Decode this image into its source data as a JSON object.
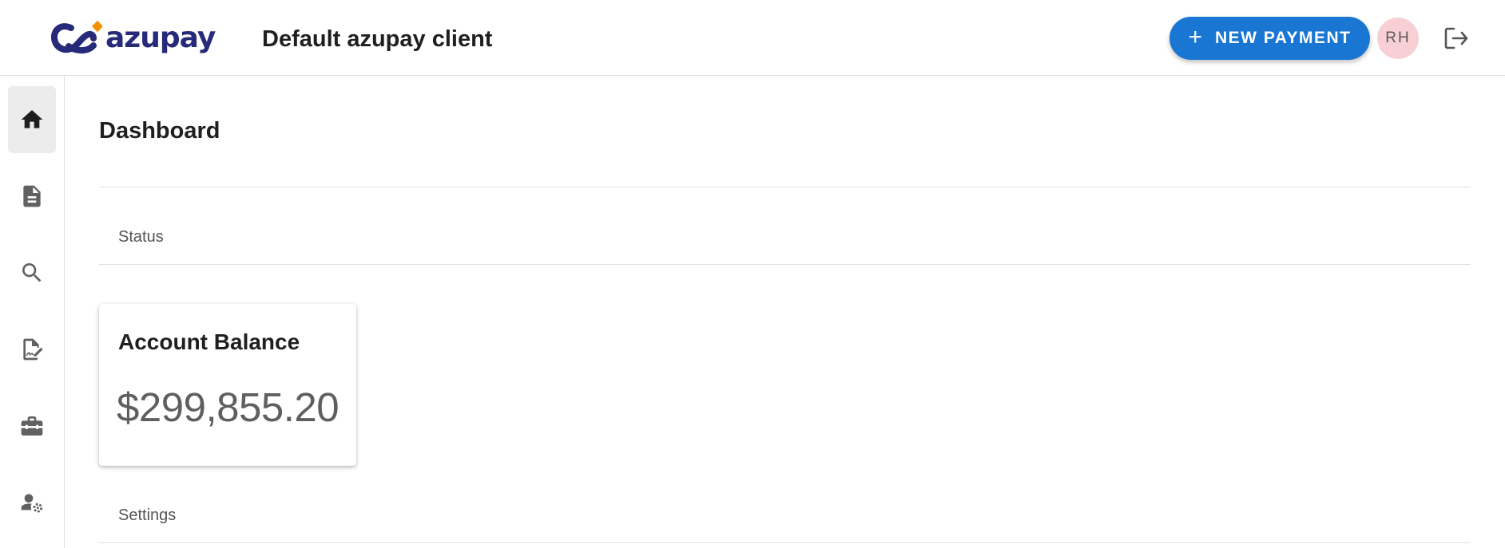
{
  "header": {
    "logo_text": "azupay",
    "client_name": "Default azupay client",
    "new_payment_label": "NEW PAYMENT",
    "avatar_initials": "RH"
  },
  "sidebar": {
    "items": [
      {
        "icon": "home-icon",
        "active": true
      },
      {
        "icon": "document-icon",
        "active": false
      },
      {
        "icon": "search-icon",
        "active": false
      },
      {
        "icon": "signature-document-icon",
        "active": false
      },
      {
        "icon": "toolbox-icon",
        "active": false
      },
      {
        "icon": "user-settings-icon",
        "active": false
      }
    ]
  },
  "main": {
    "title": "Dashboard",
    "status_label": "Status",
    "settings_label": "Settings",
    "balance_card": {
      "title": "Account Balance",
      "value": "$299,855.20"
    }
  },
  "colors": {
    "primary": "#1976d2",
    "brand_navy": "#262a78",
    "brand_orange": "#f39200",
    "avatar_bg": "#f8cfd4"
  }
}
